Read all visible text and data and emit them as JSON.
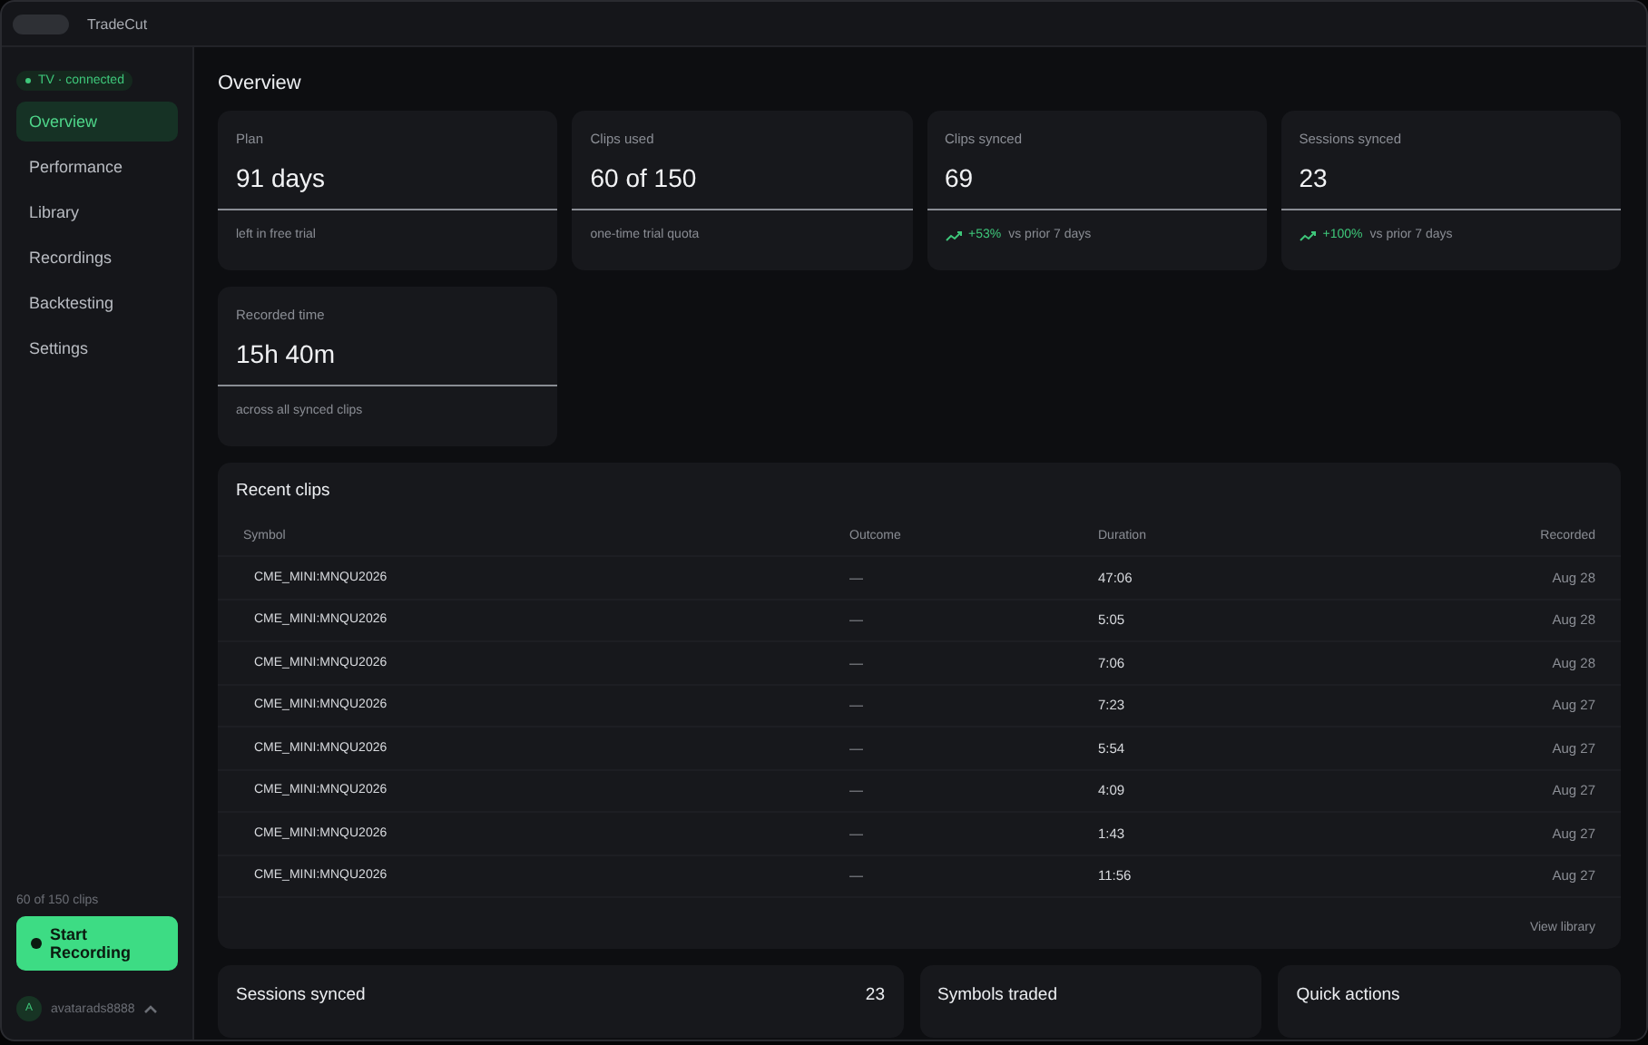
{
  "window": {
    "title": "TradeCut"
  },
  "sidebar": {
    "status": "TV · connected",
    "items": [
      {
        "label": "Overview",
        "selected": true
      },
      {
        "label": "Performance",
        "selected": false
      },
      {
        "label": "Library",
        "selected": false
      },
      {
        "label": "Recordings",
        "selected": false
      },
      {
        "label": "Backtesting",
        "selected": false
      },
      {
        "label": "Settings",
        "selected": false
      }
    ],
    "usage": "60 of 150 clips",
    "record_button": "Start Recording",
    "user": {
      "initial": "A",
      "name": "avatarads8888"
    }
  },
  "page_title": "Overview",
  "stats": [
    {
      "label": "Plan",
      "value": "91 days",
      "note": "left in free trial"
    },
    {
      "label": "Clips used",
      "value": "60 of 150",
      "note": "one-time trial quota"
    },
    {
      "label": "Clips synced",
      "value": "69",
      "delta": "+53%",
      "note": "vs prior 7 days"
    },
    {
      "label": "Sessions synced",
      "value": "23",
      "delta": "+100%",
      "note": "vs prior 7 days"
    },
    {
      "label": "Recorded time",
      "value": "15h 40m",
      "note": "across all synced clips"
    }
  ],
  "recent_clips": {
    "title": "Recent clips",
    "columns": [
      "Symbol",
      "Outcome",
      "Duration",
      "Recorded"
    ],
    "rows": [
      [
        "CME_MINI:MNQU2026",
        "—",
        "47:06",
        "Aug 28"
      ],
      [
        "CME_MINI:MNQU2026",
        "—",
        "5:05",
        "Aug 28"
      ],
      [
        "CME_MINI:MNQU2026",
        "—",
        "7:06",
        "Aug 28"
      ],
      [
        "CME_MINI:MNQU2026",
        "—",
        "7:23",
        "Aug 27"
      ],
      [
        "CME_MINI:MNQU2026",
        "—",
        "5:54",
        "Aug 27"
      ],
      [
        "CME_MINI:MNQU2026",
        "—",
        "4:09",
        "Aug 27"
      ],
      [
        "CME_MINI:MNQU2026",
        "—",
        "1:43",
        "Aug 27"
      ],
      [
        "CME_MINI:MNQU2026",
        "—",
        "11:56",
        "Aug 27"
      ]
    ],
    "link": "View library"
  },
  "bottom_panels": [
    {
      "title": "Sessions synced",
      "count": "23"
    },
    {
      "title": "Symbols traded"
    },
    {
      "title": "Quick actions"
    }
  ]
}
